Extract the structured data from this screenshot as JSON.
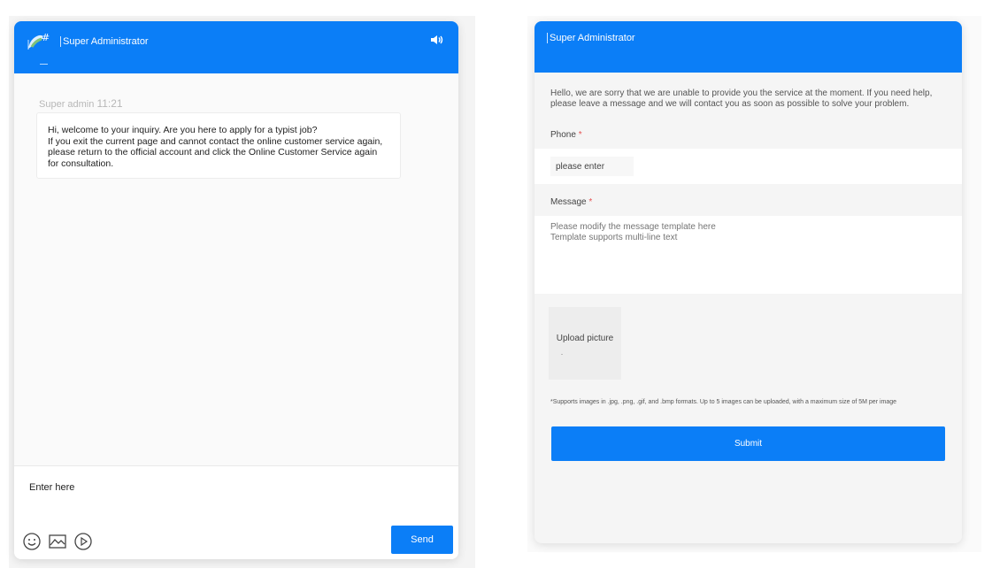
{
  "colors": {
    "accent": "#0b7ef7",
    "required": "#e55353"
  },
  "chat": {
    "header_title": "Super Administrator",
    "icons": {
      "logo": "avatar-logo-icon",
      "speaker": "speaker-icon"
    },
    "message": {
      "sender": "Super admin",
      "time": "11:21",
      "text": "Hi, welcome to your inquiry. Are you here to apply for a typist job?\nIf you exit the current page and cannot contact the online customer service again, please return to the official account and click the Online Customer Service again for consultation."
    },
    "input_placeholder": "Enter here",
    "tools": [
      "emoji-icon",
      "image-icon",
      "video-icon"
    ],
    "send_label": "Send"
  },
  "leave_message": {
    "header_title": "Super Administrator",
    "notice": "Hello, we are sorry that we are unable to provide you the service at the moment. If you need help, please leave a message and we will contact you as soon as possible to solve your problem.",
    "phone_label": "Phone",
    "required_mark": "*",
    "phone_placeholder": "please enter",
    "message_label": "Message",
    "message_placeholder": "Please modify the message template here\nTemplate supports multi-line text",
    "upload_label": "Upload picture",
    "support_note": "*Supports images in .jpg, .png, .gif, and .bmp formats. Up to 5 images can be uploaded, with a maximum size of 5M per image",
    "submit_label": "Submit"
  }
}
